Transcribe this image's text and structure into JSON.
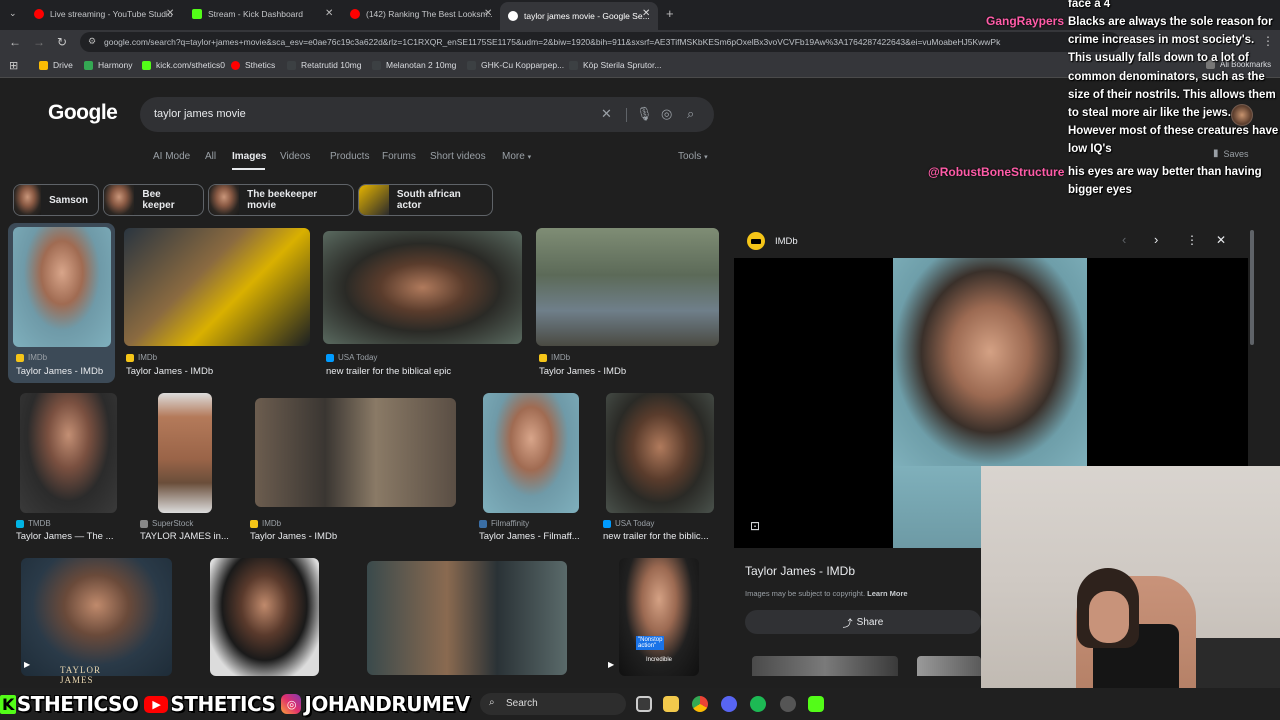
{
  "browser": {
    "tabs": [
      {
        "title": "Live streaming - YouTube Studio",
        "favicon_color": "#ff0000"
      },
      {
        "title": "Stream - Kick Dashboard",
        "favicon_color": "#53fc18"
      },
      {
        "title": "(142) Ranking The Best Looksm...",
        "favicon_color": "#ff0000"
      },
      {
        "title": "taylor james movie - Google Se...",
        "favicon_color": "#ffffff"
      }
    ],
    "url": "google.com/search?q=taylor+james+movie&sca_esv=e0ae76c19c3a622d&rlz=1C1RXQR_enSE1175SE1175&udm=2&biw=1920&bih=911&sxsrf=AE3TifMSKbKESm6pOxelBx3voVCVFb19Aw%3A1764287422643&ei=vuMoabeHJ5KwwPk",
    "bookmarks": [
      {
        "label": "Drive",
        "color": "#fbbc04"
      },
      {
        "label": "Harmony",
        "color": "#34a853"
      },
      {
        "label": "kick.com/sthetics0",
        "color": "#53fc18"
      },
      {
        "label": "Sthetics",
        "color": "#ff0000"
      },
      {
        "label": "Retatrutid 10mg",
        "color": "#3c4043"
      },
      {
        "label": "Melanotan 2 10mg",
        "color": "#3c4043"
      },
      {
        "label": "GHK-Cu Kopparpep...",
        "color": "#3c4043"
      },
      {
        "label": "Köp Sterila Sprutor...",
        "color": "#3c4043"
      }
    ],
    "all_bookmarks": "All Bookmarks"
  },
  "google": {
    "logo": "Google",
    "query": "taylor james movie",
    "filters": [
      "AI Mode",
      "All",
      "Images",
      "Videos",
      "Products",
      "Forums",
      "Short videos",
      "More"
    ],
    "tools": "Tools",
    "chips": [
      "Samson",
      "Bee keeper",
      "The beekeeper movie",
      "South african actor"
    ],
    "results_row1": [
      {
        "source": "IMDb",
        "title": "Taylor James - IMDb",
        "icon_color": "#f5c518"
      },
      {
        "source": "IMDb",
        "title": "Taylor James - IMDb",
        "icon_color": "#f5c518"
      },
      {
        "source": "USA Today",
        "title": "new trailer for the biblical epic",
        "icon_color": "#009bff"
      },
      {
        "source": "IMDb",
        "title": "Taylor James - IMDb",
        "icon_color": "#f5c518"
      }
    ],
    "results_row2": [
      {
        "source": "TMDB",
        "title": "Taylor James — The ...",
        "icon_color": "#01b4e4"
      },
      {
        "source": "SuperStock",
        "title": "TAYLOR JAMES in...",
        "icon_color": "#888888"
      },
      {
        "source": "IMDb",
        "title": "Taylor James - IMDb",
        "icon_color": "#f5c518"
      },
      {
        "source": "Filmaffinity",
        "title": "Taylor James - Filmaff...",
        "icon_color": "#3a6ea5"
      },
      {
        "source": "USA Today",
        "title": "new trailer for the biblic...",
        "icon_color": "#009bff"
      }
    ],
    "row3_captions": [
      "TAYLOR JAMES",
      "\"Nonstop action\"",
      "Incredible"
    ]
  },
  "panel": {
    "source": "IMDb",
    "title": "Taylor James - IMDb",
    "copyright": "Images may be subject to copyright.",
    "learn_more": "Learn More",
    "share": "Share",
    "saves": "Saves"
  },
  "chat": {
    "top_fragment": "face a 4",
    "user1": "GangRaypers",
    "msg1": "Blacks are always the sole reason for crime increases in most society's. This usually falls down to a lot of common denominators, such as the size of their nostrils. This allows them to steal more air like the jews. However most of these creatures have low IQ's",
    "user2": "@RobustBoneStructure",
    "msg2": "his eyes are way better than having bigger eyes"
  },
  "taskbar": {
    "brand_k": "K",
    "brand1": "STHETICSO",
    "yt_icon": "▶",
    "brand2": "STHETICS",
    "ig_icon": "◎",
    "brand3": "JOHANDRUMEV",
    "search": "Search"
  }
}
